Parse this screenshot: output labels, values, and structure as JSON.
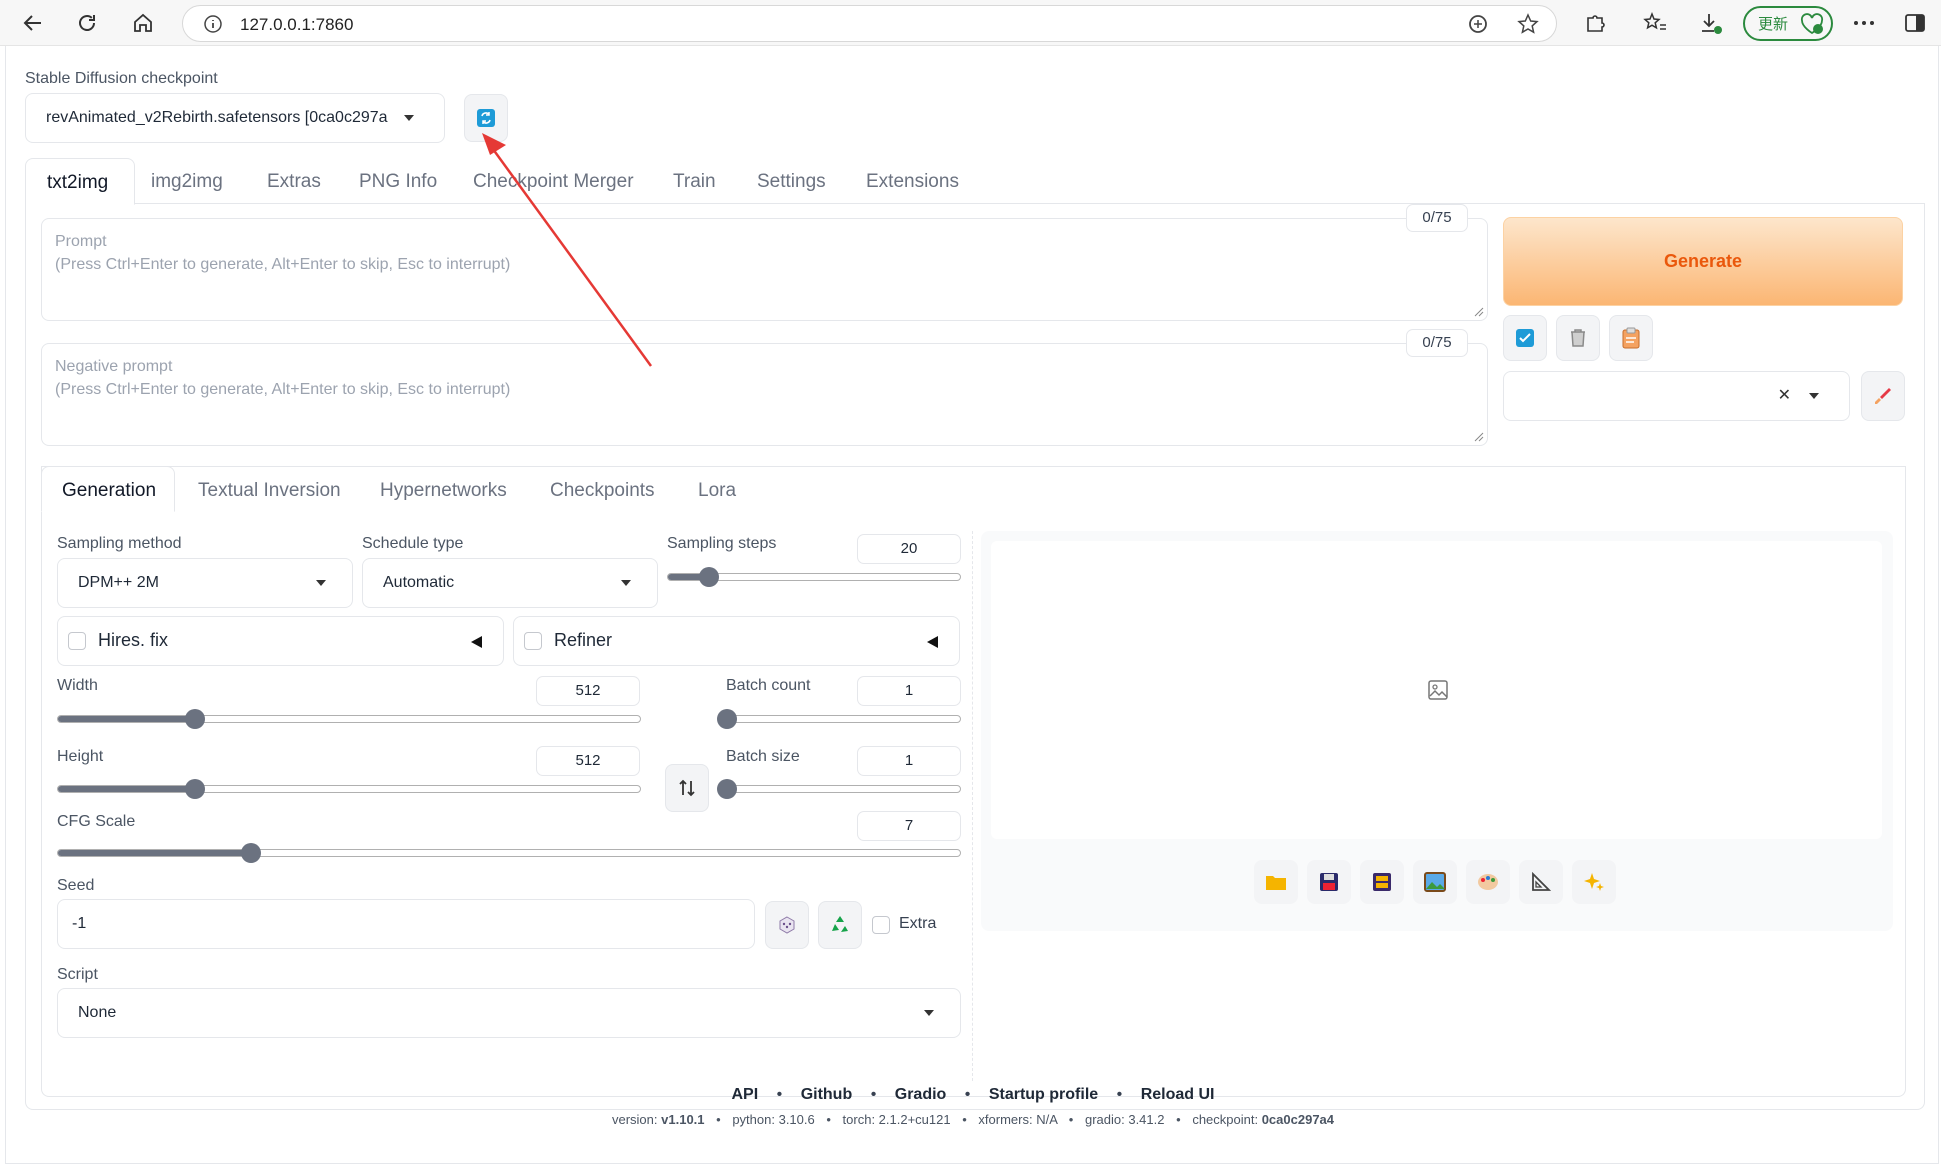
{
  "browser": {
    "url": "127.0.0.1:7860",
    "update_label": "更新"
  },
  "checkpoint": {
    "label": "Stable Diffusion checkpoint",
    "value": "revAnimated_v2Rebirth.safetensors [0ca0c297a"
  },
  "main_tabs": [
    "txt2img",
    "img2img",
    "Extras",
    "PNG Info",
    "Checkpoint Merger",
    "Train",
    "Settings",
    "Extensions"
  ],
  "prompt": {
    "label": "Prompt",
    "placeholder": "(Press Ctrl+Enter to generate, Alt+Enter to skip, Esc to interrupt)",
    "counter": "0/75"
  },
  "negative_prompt": {
    "label": "Negative prompt",
    "placeholder": "(Press Ctrl+Enter to generate, Alt+Enter to skip, Esc to interrupt)",
    "counter": "0/75"
  },
  "generate": {
    "label": "Generate",
    "color": "#f97316"
  },
  "sub_tabs": [
    "Generation",
    "Textual Inversion",
    "Hypernetworks",
    "Checkpoints",
    "Lora"
  ],
  "generation": {
    "sampling_method": {
      "label": "Sampling method",
      "value": "DPM++ 2M"
    },
    "schedule_type": {
      "label": "Schedule type",
      "value": "Automatic"
    },
    "sampling_steps": {
      "label": "Sampling steps",
      "value": "20",
      "fraction": 0.14
    },
    "hires_fix": {
      "label": "Hires. fix",
      "checked": false
    },
    "refiner": {
      "label": "Refiner",
      "checked": false
    },
    "width": {
      "label": "Width",
      "value": "512",
      "fraction": 0.235
    },
    "height": {
      "label": "Height",
      "value": "512",
      "fraction": 0.235
    },
    "batch_count": {
      "label": "Batch count",
      "value": "1",
      "fraction": 0.0
    },
    "batch_size": {
      "label": "Batch size",
      "value": "1",
      "fraction": 0.0
    },
    "cfg_scale": {
      "label": "CFG Scale",
      "value": "7",
      "fraction": 0.214
    },
    "seed": {
      "label": "Seed",
      "value": "-1"
    },
    "extra": {
      "label": "Extra",
      "checked": false
    },
    "script": {
      "label": "Script",
      "value": "None"
    }
  },
  "output_tools": [
    "folder-icon",
    "save-icon",
    "zip-icon",
    "image-icon",
    "palette-icon",
    "triangle-ruler-icon",
    "sparkles-icon"
  ],
  "footer": {
    "links": [
      "API",
      "Github",
      "Gradio",
      "Startup profile",
      "Reload UI"
    ],
    "version_label": "version:",
    "version": "v1.10.1",
    "python": "python: 3.10.6",
    "torch": "torch: 2.1.2+cu121",
    "xformers": "xformers: N/A",
    "gradio": "gradio: 3.41.2",
    "checkpoint_label": "checkpoint:",
    "checkpoint": "0ca0c297a4"
  }
}
